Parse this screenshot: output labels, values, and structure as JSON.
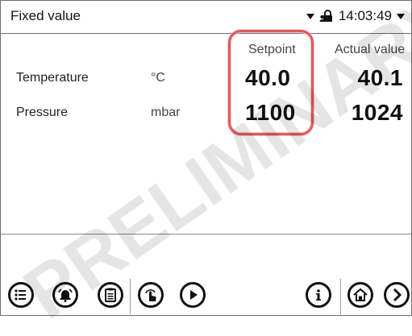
{
  "titlebar": {
    "title": "Fixed value",
    "time": "14:03:49"
  },
  "table": {
    "headers": {
      "setpoint": "Setpoint",
      "actual": "Actual value"
    },
    "rows": [
      {
        "label": "Temperature",
        "unit": "°C",
        "setpoint": "40.0",
        "actual": "40.1"
      },
      {
        "label": "Pressure",
        "unit": "mbar",
        "setpoint": "1100",
        "actual": "1024"
      }
    ]
  },
  "highlight": {
    "color": "#e05a5a",
    "target": "setpoint-column"
  },
  "watermark": {
    "text": "PRELIMINARY"
  },
  "bottom_icons": [
    "list-menu-icon",
    "alarm-bell-icon",
    "clipboard-icon",
    "touch-hand-icon",
    "play-icon",
    "info-icon",
    "home-icon",
    "next-arrow-icon"
  ]
}
